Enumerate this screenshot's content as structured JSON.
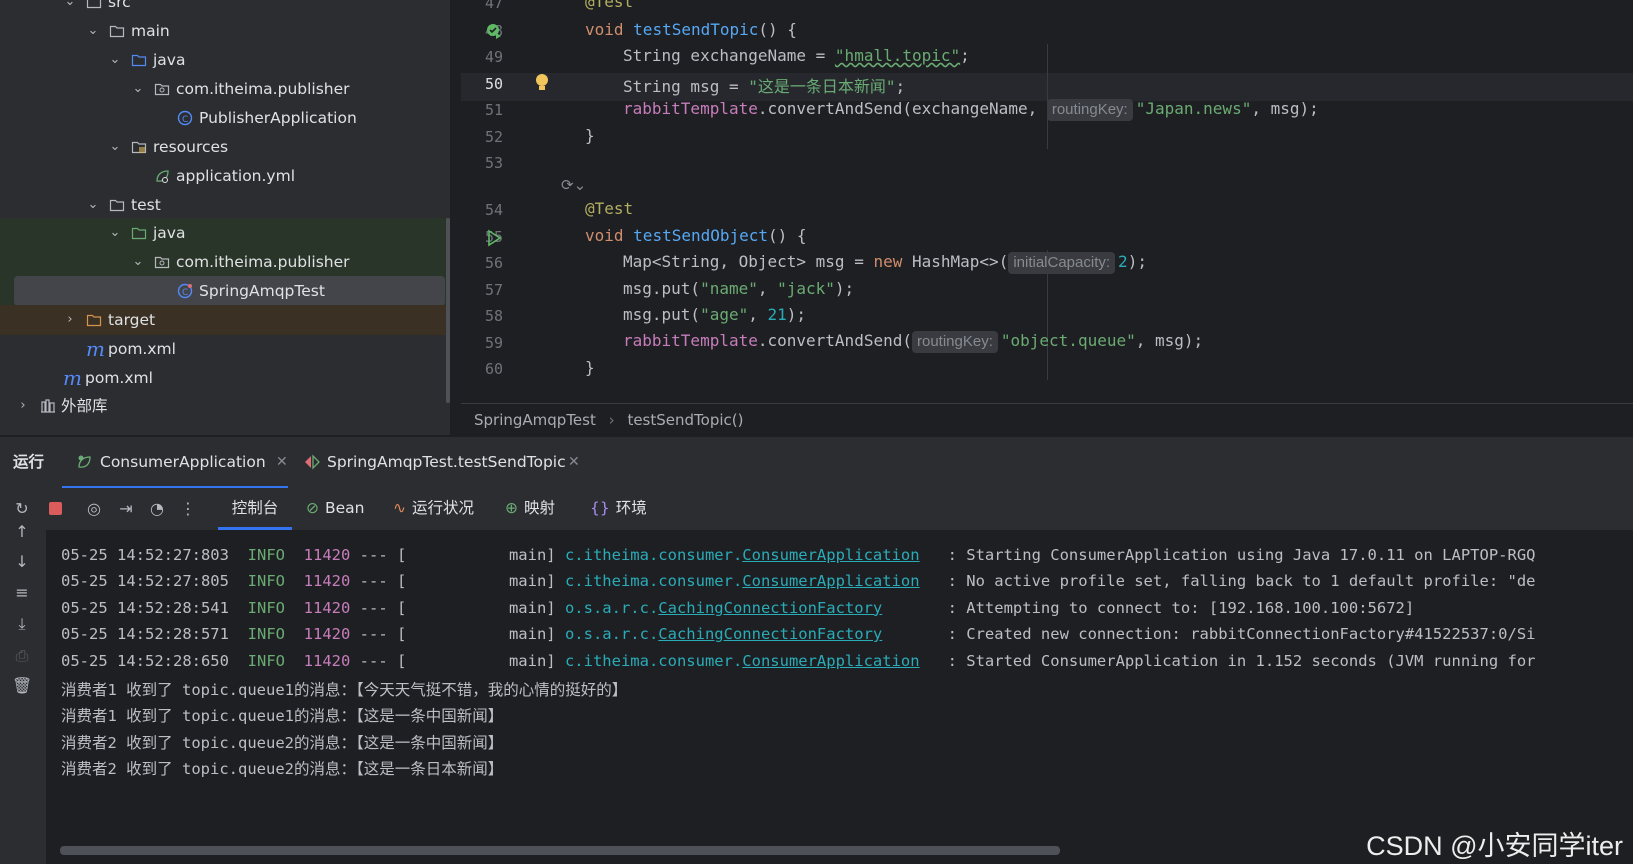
{
  "project_tree": {
    "items": [
      {
        "label": "src",
        "icon": "folder-icon"
      },
      {
        "label": "main",
        "icon": "folder-icon"
      },
      {
        "label": "java",
        "icon": "source-folder-icon"
      },
      {
        "label": "com.itheima.publisher",
        "icon": "package-icon"
      },
      {
        "label": "PublisherApplication",
        "icon": "spring-boot-class-icon"
      },
      {
        "label": "resources",
        "icon": "resources-folder-icon"
      },
      {
        "label": "application.yml",
        "icon": "spring-yaml-icon"
      },
      {
        "label": "test",
        "icon": "folder-icon"
      },
      {
        "label": "java",
        "icon": "test-source-folder-icon"
      },
      {
        "label": "com.itheima.publisher",
        "icon": "package-icon"
      },
      {
        "label": "SpringAmqpTest",
        "icon": "class-icon"
      },
      {
        "label": "target",
        "icon": "excluded-folder-icon"
      },
      {
        "label": "pom.xml",
        "icon": "maven-icon"
      },
      {
        "label": "pom.xml",
        "icon": "maven-icon"
      },
      {
        "label": "外部库",
        "icon": "library-icon"
      }
    ]
  },
  "editor": {
    "line_numbers": [
      "47",
      "48",
      "49",
      "50",
      "51",
      "52",
      "53",
      "54",
      "55",
      "56",
      "57",
      "58",
      "59",
      "60"
    ],
    "current_line": "50",
    "code": {
      "l47": "@Test",
      "l48_kw": "void",
      "l48_fn": "testSendTopic",
      "l48_rest": "() {",
      "l49_a": "String exchangeName = ",
      "l49_str": "\"hmall.topic\"",
      "l49_end": ";",
      "l50_a": "String msg = ",
      "l50_str": "\"这是一条日本新闻\"",
      "l50_end": ";",
      "l51_fld": "rabbitTemplate",
      "l51_a": ".convertAndSend(exchangeName, ",
      "l51_hint": "routingKey:",
      "l51_str": "\"Japan.news\"",
      "l51_end": ", msg);",
      "l52": "}",
      "l54": "@Test",
      "l55_kw": "void",
      "l55_fn": "testSendObject",
      "l55_rest": "() {",
      "l56_a": "Map<String, Object> msg = ",
      "l56_kw": "new",
      "l56_b": " HashMap<>(",
      "l56_hint": "initialCapacity:",
      "l56_num": "2",
      "l56_end": ");",
      "l57_a": "msg.put(",
      "l57_s1": "\"name\"",
      "l57_b": ", ",
      "l57_s2": "\"jack\"",
      "l57_end": ");",
      "l58_a": "msg.put(",
      "l58_s1": "\"age\"",
      "l58_b": ", ",
      "l58_num": "21",
      "l58_end": ");",
      "l59_fld": "rabbitTemplate",
      "l59_a": ".convertAndSend(",
      "l59_hint": "routingKey:",
      "l59_str": "\"object.queue\"",
      "l59_end": ", msg);",
      "l60": "}"
    },
    "breadcrumb": [
      "SpringAmqpTest",
      "testSendTopic()"
    ]
  },
  "run_panel": {
    "title": "运行",
    "tabs": [
      {
        "label": "ConsumerApplication",
        "active": true
      },
      {
        "label": "SpringAmqpTest.testSendTopic",
        "active": false
      }
    ],
    "view_tabs": [
      {
        "label": "控制台",
        "icon": "",
        "active": true
      },
      {
        "label": "Bean",
        "icon": "bean-icon"
      },
      {
        "label": "运行状况",
        "icon": "health-icon"
      },
      {
        "label": "映射",
        "icon": "mappings-icon"
      },
      {
        "label": "环境",
        "icon": "environment-icon"
      }
    ]
  },
  "console": {
    "log_lines": [
      {
        "ts": "05-25 14:52:27:803",
        "level": "INFO",
        "pid": "11420",
        "sep": " --- [",
        "thread": "           main] ",
        "pkg": "c.itheima.consumer.",
        "cls": "ConsumerApplication",
        "pad": "   ",
        "msg": ": Starting ConsumerApplication using Java 17.0.11 on LAPTOP-RGQ"
      },
      {
        "ts": "05-25 14:52:27:805",
        "level": "INFO",
        "pid": "11420",
        "sep": " --- [",
        "thread": "           main] ",
        "pkg": "c.itheima.consumer.",
        "cls": "ConsumerApplication",
        "pad": "   ",
        "msg": ": No active profile set, falling back to 1 default profile: \"de"
      },
      {
        "ts": "05-25 14:52:28:541",
        "level": "INFO",
        "pid": "11420",
        "sep": " --- [",
        "thread": "           main] ",
        "pkg": "o.s.a.r.c.",
        "cls": "CachingConnectionFactory",
        "pad": "       ",
        "msg": ": Attempting to connect to: [192.168.100.100:5672]"
      },
      {
        "ts": "05-25 14:52:28:571",
        "level": "INFO",
        "pid": "11420",
        "sep": " --- [",
        "thread": "           main] ",
        "pkg": "o.s.a.r.c.",
        "cls": "CachingConnectionFactory",
        "pad": "       ",
        "msg": ": Created new connection: rabbitConnectionFactory#41522537:0/Si"
      },
      {
        "ts": "05-25 14:52:28:650",
        "level": "INFO",
        "pid": "11420",
        "sep": " --- [",
        "thread": "           main] ",
        "pkg": "c.itheima.consumer.",
        "cls": "ConsumerApplication",
        "pad": "   ",
        "msg": ": Started ConsumerApplication in 1.152 seconds (JVM running for"
      }
    ],
    "output_lines": [
      "消费者1 收到了 topic.queue1的消息：【今天天气挺不错，我的心情的挺好的】",
      "消费者1 收到了 topic.queue1的消息：【这是一条中国新闻】",
      "消费者2 收到了 topic.queue2的消息：【这是一条中国新闻】",
      "消费者2 收到了 topic.queue2的消息：【这是一条日本新闻】"
    ]
  },
  "watermark": "CSDN @小安同学iter",
  "colors": {
    "accent": "#3574f0",
    "keyword": "#cf8e6d",
    "string": "#6aab73",
    "function": "#56a8f5",
    "field": "#c77dbb",
    "number": "#2aacb8"
  }
}
